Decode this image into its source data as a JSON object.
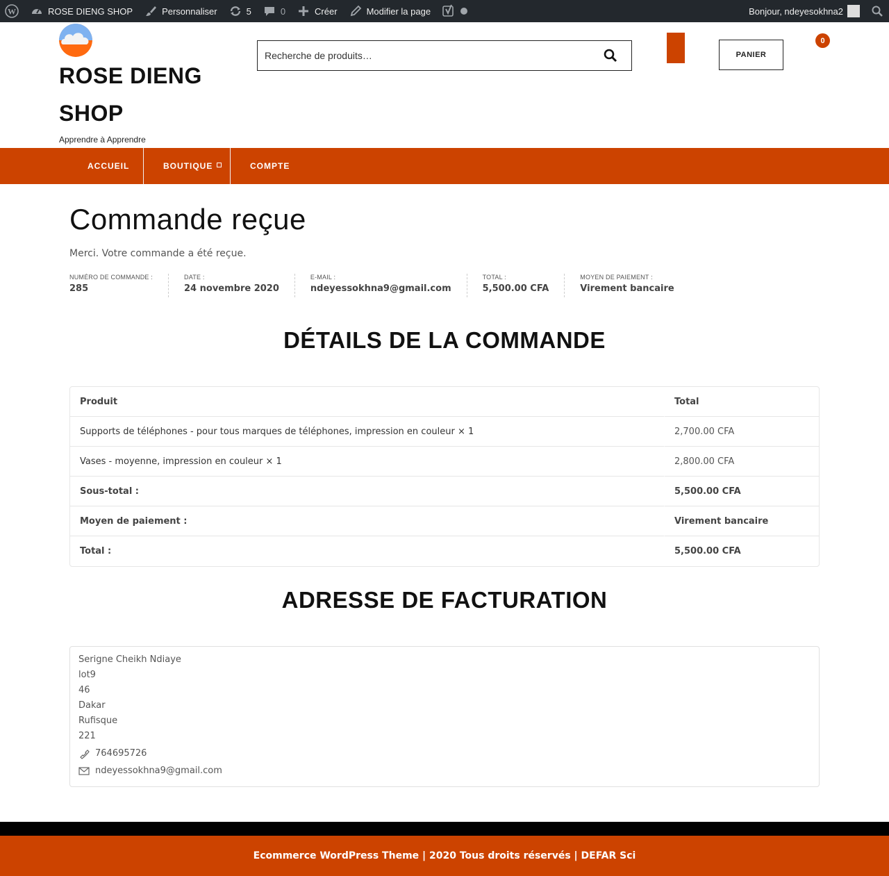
{
  "adminbar": {
    "site_name": "ROSE DIENG SHOP",
    "customize": "Personnaliser",
    "updates_count": "5",
    "comments_count": "0",
    "new": "Créer",
    "edit_page": "Modifier la page",
    "greeting": "Bonjour, ndeyesokhna2"
  },
  "header": {
    "title_line1": "ROSE DIENG",
    "title_line2": "SHOP",
    "tagline": "Apprendre à Apprendre",
    "search_placeholder": "Recherche de produits…",
    "cart_label": "PANIER",
    "cart_count": "0"
  },
  "nav": {
    "items": [
      {
        "label": "ACCUEIL"
      },
      {
        "label": "BOUTIQUE"
      },
      {
        "label": "COMPTE"
      }
    ]
  },
  "order": {
    "title": "Commande reçue",
    "thanks": "Merci. Votre commande a été reçue.",
    "overview": [
      {
        "label": "NUMÉRO DE COMMANDE :",
        "value": "285"
      },
      {
        "label": "DATE :",
        "value": "24 novembre 2020"
      },
      {
        "label": "E-MAIL :",
        "value": "ndeyessokhna9@gmail.com"
      },
      {
        "label": "TOTAL :",
        "value": "5,500.00 CFA"
      },
      {
        "label": "MOYEN DE PAIEMENT :",
        "value": "Virement bancaire"
      }
    ]
  },
  "details": {
    "heading": "DÉTAILS DE LA COMMANDE",
    "col_product": "Produit",
    "col_total": "Total",
    "items": [
      {
        "name": "Supports de téléphones - pour tous marques de téléphones, impression en couleur",
        "qty": "× 1",
        "total": "2,700.00 CFA"
      },
      {
        "name": "Vases - moyenne, impression en couleur",
        "qty": "× 1",
        "total": "2,800.00 CFA"
      }
    ],
    "subtotal_label": "Sous-total :",
    "subtotal": "5,500.00 CFA",
    "payment_label": "Moyen de paiement :",
    "payment": "Virement bancaire",
    "total_label": "Total :",
    "total": "5,500.00 CFA"
  },
  "billing": {
    "heading": "ADRESSE DE FACTURATION",
    "name": "Serigne Cheikh Ndiaye",
    "line1": "lot9",
    "line2": "46",
    "city": "Dakar",
    "state": "Rufisque",
    "postcode": "221",
    "phone": "764695726",
    "email": "ndeyessokhna9@gmail.com"
  },
  "footer": {
    "text": "Ecommerce WordPress Theme | 2020 Tous droits réservés | DEFAR Sci"
  },
  "colors": {
    "accent": "#cc4300",
    "adminbar": "#23282d"
  }
}
